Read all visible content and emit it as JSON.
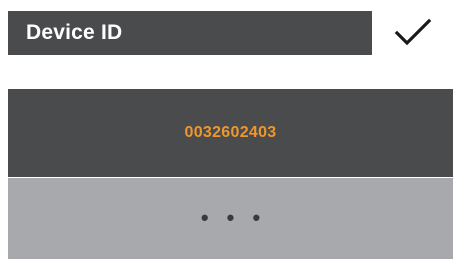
{
  "header": {
    "title": "Device ID",
    "confirm_icon": "checkmark-icon"
  },
  "device": {
    "id_value": "0032602403"
  },
  "more": {
    "label": "• • •",
    "icon": "ellipsis-icon"
  },
  "colors": {
    "panel_dark": "#4a4b4d",
    "panel_light": "#a8a9ad",
    "accent": "#f0962a",
    "title_text": "#ffffff"
  }
}
